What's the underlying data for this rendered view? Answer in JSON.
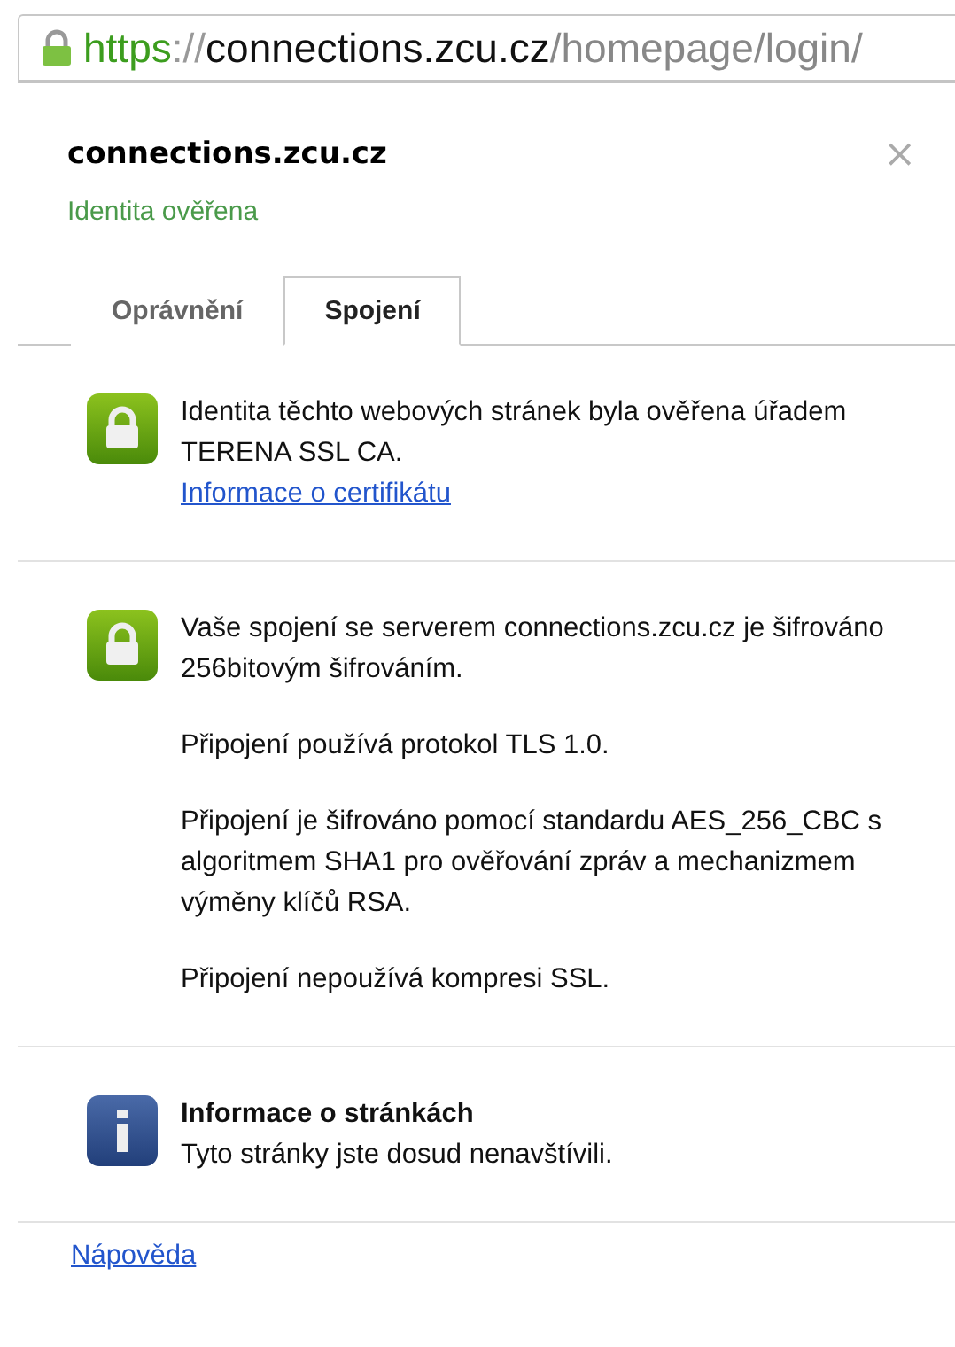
{
  "address_bar": {
    "url_parts": [
      {
        "kind": "scheme",
        "text": "https"
      },
      {
        "kind": "separator",
        "text": "://"
      },
      {
        "kind": "host",
        "text": "connections.zcu.cz"
      },
      {
        "kind": "path",
        "text": "/homepage/login/"
      }
    ]
  },
  "popup": {
    "title": "connections.zcu.cz",
    "status": "Identita ověřena",
    "close": "×",
    "tabs": [
      {
        "label": "Oprávnění",
        "selected": false
      },
      {
        "label": "Spojení",
        "selected": true
      }
    ],
    "sections": [
      {
        "kind": "lock",
        "paragraphs": [
          "Identita těchto webových stránek byla ověřena úřadem TERENA SSL CA."
        ],
        "link": "Informace o certifikátu"
      },
      {
        "kind": "lock",
        "paragraphs": [
          "Vaše spojení se serverem connections.zcu.cz je šifrováno 256bitovým šifrováním.",
          "Připojení používá protokol TLS 1.0.",
          "Připojení je šifrováno pomocí standardu AES_256_CBC s algoritmem SHA1 pro ověřování zpráv a mechanizmem výměny klíčů RSA.",
          "Připojení nepoužívá kompresi SSL."
        ]
      },
      {
        "kind": "info",
        "heading": "Informace o stránkách",
        "paragraphs": [
          "Tyto stránky jste dosud nenavštívili."
        ]
      }
    ],
    "help_link": "Nápověda"
  }
}
